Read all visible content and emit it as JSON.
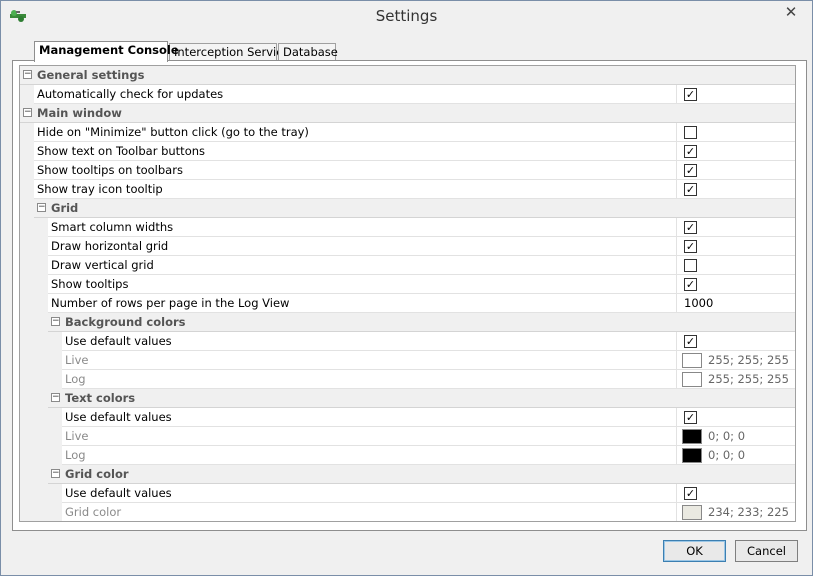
{
  "window": {
    "title": "Settings",
    "close_glyph": "✕"
  },
  "tabs": [
    {
      "label": "Management Console",
      "active": true
    },
    {
      "label": "Interception Service",
      "active": false
    },
    {
      "label": "Database",
      "active": false
    }
  ],
  "check_glyph": "✓",
  "collapse_glyph": "−",
  "categories": {
    "general": "General settings",
    "main_window": "Main window",
    "grid": "Grid",
    "background_colors": "Background colors",
    "text_colors": "Text colors",
    "grid_color": "Grid color"
  },
  "properties": {
    "auto_update": {
      "label": "Automatically check for updates",
      "checked": true
    },
    "hide_minimize": {
      "label": "Hide on \"Minimize\" button click (go to the tray)",
      "checked": false
    },
    "toolbar_text": {
      "label": "Show text on Toolbar buttons",
      "checked": true
    },
    "toolbar_tooltips": {
      "label": "Show tooltips on toolbars",
      "checked": true
    },
    "tray_tooltip": {
      "label": "Show tray icon tooltip",
      "checked": true
    },
    "smart_columns": {
      "label": "Smart column widths",
      "checked": true
    },
    "horiz_grid": {
      "label": "Draw horizontal grid",
      "checked": true
    },
    "vert_grid": {
      "label": "Draw vertical grid",
      "checked": false
    },
    "show_tooltips": {
      "label": "Show tooltips",
      "checked": true
    },
    "rows_per_page": {
      "label": "Number of rows per page in the Log View",
      "value": "1000"
    },
    "bg_default": {
      "label": "Use default values",
      "checked": true
    },
    "bg_live": {
      "label": "Live",
      "color": "#ffffff",
      "text": "255; 255; 255"
    },
    "bg_log": {
      "label": "Log",
      "color": "#ffffff",
      "text": "255; 255; 255"
    },
    "text_default": {
      "label": "Use default values",
      "checked": true
    },
    "text_live": {
      "label": "Live",
      "color": "#000000",
      "text": "0; 0; 0"
    },
    "text_log": {
      "label": "Log",
      "color": "#000000",
      "text": "0; 0; 0"
    },
    "gridc_default": {
      "label": "Use default values",
      "checked": true
    },
    "gridc_color": {
      "label": "Grid color",
      "color": "#eae9e1",
      "text": "234; 233; 225"
    }
  },
  "buttons": {
    "ok": "OK",
    "cancel": "Cancel"
  }
}
